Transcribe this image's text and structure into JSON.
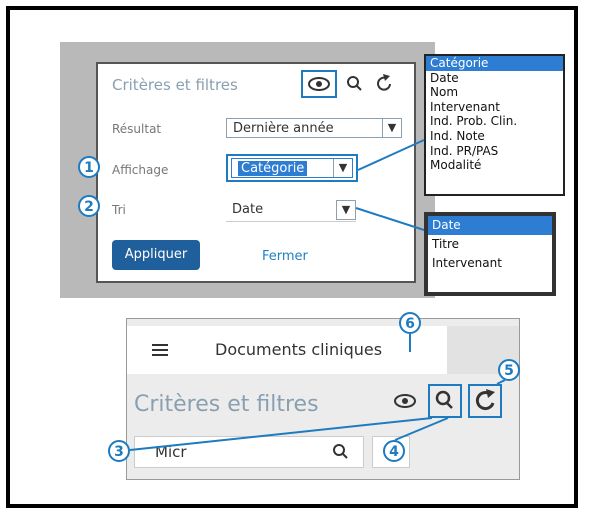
{
  "top": {
    "title": "Critères et filtres",
    "rows": [
      {
        "label": "Résultat",
        "value": "Dernière année"
      },
      {
        "label": "Affichage",
        "value": "Catégorie"
      },
      {
        "label": "Tri",
        "value": "Date"
      }
    ],
    "apply_label": "Appliquer",
    "close_label": "Fermer"
  },
  "affichage_options": [
    "Catégorie",
    "Date",
    "Nom",
    "Intervenant",
    "Ind. Prob. Clin.",
    "Ind. Note",
    "Ind. PR/PAS",
    "Modalité"
  ],
  "tri_options": [
    "Date",
    "Titre",
    "Intervenant"
  ],
  "bottom": {
    "header": "Documents cliniques",
    "title": "Critères et filtres",
    "search_value": "Micr",
    "alert_glyph": "!"
  },
  "callouts": [
    "1",
    "2",
    "3",
    "4",
    "5",
    "6"
  ],
  "colors": {
    "accent": "#1e7bc0",
    "apply_button": "#1f5f9c",
    "selected_option": "#2d7dd2"
  }
}
